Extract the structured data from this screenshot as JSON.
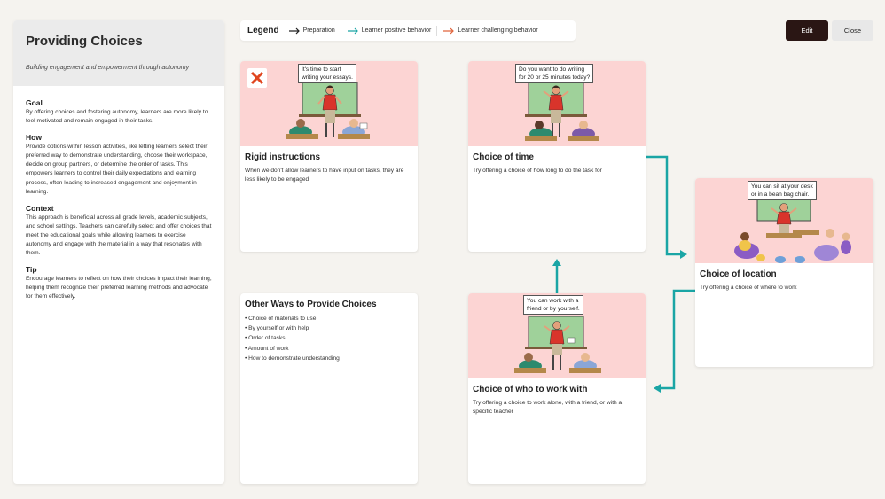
{
  "left": {
    "title": "Providing Choices",
    "subtitle": "Building engagement and empowerment through autonomy",
    "sections": [
      {
        "heading": "Goal",
        "text": "By offering choices and fostering autonomy, learners are more likely to feel motivated and remain engaged in their tasks."
      },
      {
        "heading": "How",
        "text": "Provide options within lesson activities, like letting learners select their preferred way to demonstrate understanding, choose their workspace, decide on group partners, or determine the order of tasks. This empowers learners to control their daily expectations and learning process, often leading to increased engagement and enjoyment in learning."
      },
      {
        "heading": "Context",
        "text": "This approach is beneficial across all grade levels, academic subjects, and school settings. Teachers can carefully select and offer choices that meet the educational goals while allowing learners to exercise autonomy and engage with the material in a way that resonates with them."
      },
      {
        "heading": "Tip",
        "text": "Encourage learners to reflect on how their choices impact their learning, helping them recognize their preferred learning methods and advocate for them effectively."
      }
    ]
  },
  "legend": {
    "title": "Legend",
    "items": [
      {
        "label": "Preparation",
        "color": "#222222"
      },
      {
        "label": "Learner positive behavior",
        "color": "#1aa5a5"
      },
      {
        "label": "Learner challenging behavior",
        "color": "#e0643c"
      }
    ]
  },
  "buttons": {
    "edit": "Edit",
    "close": "Close"
  },
  "cards": {
    "rigid": {
      "bubble": "It's time to start writing your essays.",
      "title": "Rigid instructions",
      "desc": "When we don't allow learners to have input on tasks, they are less likely to be engaged"
    },
    "time": {
      "bubble": "Do you want to do writing for 20 or 25 minutes today?",
      "title": "Choice of time",
      "desc": "Try offering a choice of how long to do the task for"
    },
    "location": {
      "bubble": "You can sit at your desk or in a bean bag chair.",
      "title": "Choice of location",
      "desc": "Try offering a choice of where to work"
    },
    "who": {
      "bubble": "You can work with a friend or by yourself.",
      "title": "Choice of who to work with",
      "desc": "Try offering a choice to work alone, with a friend, or with a specific teacher"
    },
    "other": {
      "title": "Other Ways to Provide Choices",
      "items": [
        "Choice of materials to use",
        "By yourself or with help",
        "Order of tasks",
        "Amount of work",
        "How to demonstrate understanding"
      ]
    }
  },
  "colors": {
    "card_image_bg": "#fcd4d3",
    "connector": "#1aa5a5",
    "edit_button": "#2a1614",
    "reject_x": "#e0461f"
  },
  "icons": {
    "reject": "x-icon"
  }
}
